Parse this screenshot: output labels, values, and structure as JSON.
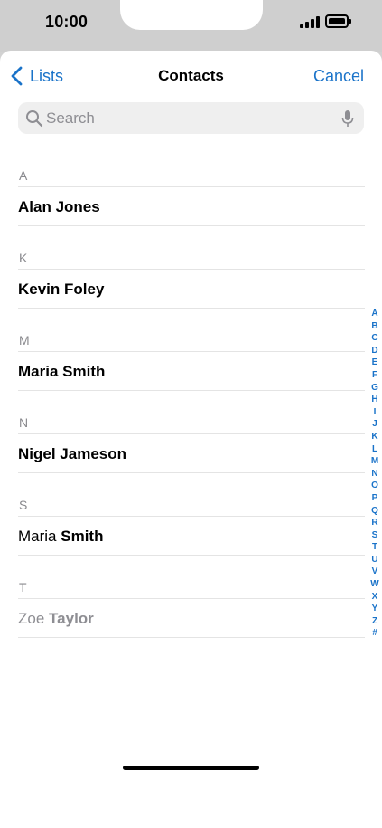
{
  "status": {
    "time": "10:00"
  },
  "nav": {
    "back_label": "Lists",
    "title": "Contacts",
    "cancel_label": "Cancel"
  },
  "search": {
    "placeholder": "Search",
    "value": ""
  },
  "sections": [
    {
      "letter": "A",
      "contacts": [
        {
          "first": "Alan",
          "last": "Jones"
        }
      ]
    },
    {
      "letter": "K",
      "contacts": [
        {
          "first": "Kevin",
          "last": "Foley"
        }
      ]
    },
    {
      "letter": "M",
      "contacts": [
        {
          "first": "Maria",
          "last": "Smith"
        }
      ]
    },
    {
      "letter": "N",
      "contacts": [
        {
          "first": "Nigel",
          "last": "Jameson"
        }
      ]
    },
    {
      "letter": "S",
      "contacts": [
        {
          "first": "Maria",
          "last": "Smith"
        }
      ]
    },
    {
      "letter": "T",
      "contacts": [
        {
          "first": "Zoe",
          "last": "Taylor"
        }
      ]
    }
  ],
  "index_letters": [
    "A",
    "B",
    "C",
    "D",
    "E",
    "F",
    "G",
    "H",
    "I",
    "J",
    "K",
    "L",
    "M",
    "N",
    "O",
    "P",
    "Q",
    "R",
    "S",
    "T",
    "U",
    "V",
    "W",
    "X",
    "Y",
    "Z",
    "#"
  ],
  "colors": {
    "accent": "#1a73c9",
    "statusbar": "#cfcfcf",
    "separator": "#e4e4e4",
    "secondary_text": "#8e8e93"
  },
  "icons": {
    "back": "chevron-left-icon",
    "search": "search-icon",
    "mic": "microphone-icon",
    "signal": "cellular-signal-icon",
    "battery": "battery-icon"
  }
}
